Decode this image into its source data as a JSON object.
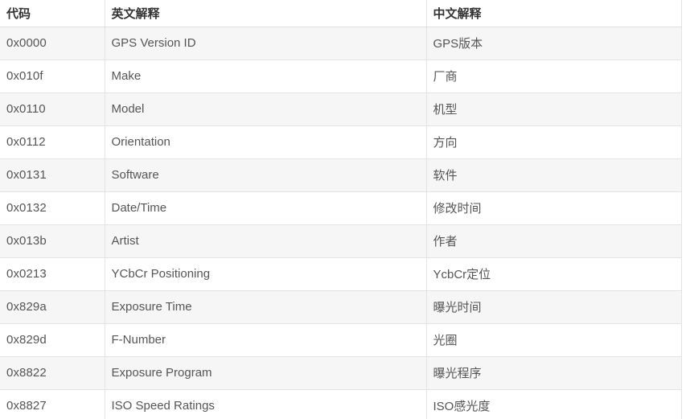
{
  "table": {
    "headers": [
      {
        "key": "code",
        "label": "代码"
      },
      {
        "key": "english",
        "label": "英文解释"
      },
      {
        "key": "chinese",
        "label": "中文解释"
      }
    ],
    "rows": [
      {
        "code": "0x0000",
        "english": "GPS Version ID",
        "chinese": "GPS版本"
      },
      {
        "code": "0x010f",
        "english": "Make",
        "chinese": "厂商"
      },
      {
        "code": "0x0110",
        "english": "Model",
        "chinese": "机型"
      },
      {
        "code": "0x0112",
        "english": "Orientation",
        "chinese": "方向"
      },
      {
        "code": "0x0131",
        "english": "Software",
        "chinese": "软件"
      },
      {
        "code": "0x0132",
        "english": "Date/Time",
        "chinese": "修改时间"
      },
      {
        "code": "0x013b",
        "english": "Artist",
        "chinese": "作者"
      },
      {
        "code": "0x0213",
        "english": "YCbCr Positioning",
        "chinese": "YcbCr定位"
      },
      {
        "code": "0x829a",
        "english": "Exposure Time",
        "chinese": "曝光时间"
      },
      {
        "code": "0x829d",
        "english": "F-Number",
        "chinese": "光圈"
      },
      {
        "code": "0x8822",
        "english": "Exposure Program",
        "chinese": "曝光程序"
      },
      {
        "code": "0x8827",
        "english": "ISO Speed Ratings",
        "chinese": "ISO感光度"
      }
    ]
  },
  "colors": {
    "header_text": "#333333",
    "body_text": "#555555",
    "stripe_background": "#f6f6f6",
    "plain_background": "#ffffff",
    "border": "#e3e3e3",
    "header_border": "#dddddd"
  }
}
